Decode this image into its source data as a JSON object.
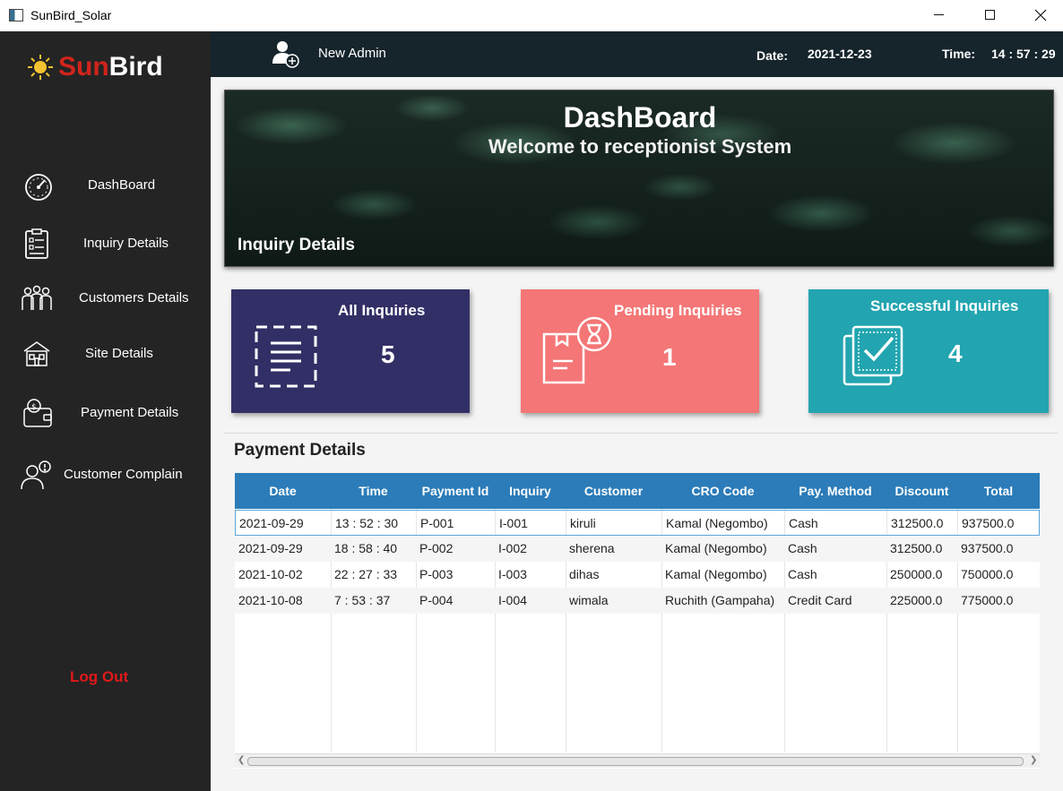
{
  "window": {
    "title": "SunBird_Solar"
  },
  "logo": {
    "sun": "Sun",
    "bird": "Bird"
  },
  "sidebar": {
    "items": [
      {
        "label": "DashBoard",
        "icon": "speedometer-icon"
      },
      {
        "label": "Inquiry Details",
        "icon": "clipboard-icon"
      },
      {
        "label": "Customers Details",
        "icon": "people-icon"
      },
      {
        "label": "Site Details",
        "icon": "house-icon"
      },
      {
        "label": "Payment Details",
        "icon": "wallet-icon"
      },
      {
        "label": "Customer Complain",
        "icon": "complaint-icon"
      }
    ],
    "logout": "Log Out"
  },
  "header": {
    "admin_name": "New Admin",
    "date_label": "Date:",
    "date_value": "2021-12-23",
    "time_label": "Time:",
    "time_value": "14 : 57 : 29"
  },
  "banner": {
    "title": "DashBoard",
    "subtitle": "Welcome to receptionist System",
    "section": "Inquiry Details"
  },
  "cards": [
    {
      "title": "All Inquiries",
      "value": "5",
      "color": "#322f66",
      "icon": "list-icon"
    },
    {
      "title": "Pending Inquiries",
      "value": "1",
      "color": "#f47676",
      "icon": "hourglass-box-icon"
    },
    {
      "title": "Successful Inquiries",
      "value": "4",
      "color": "#22a5b0",
      "icon": "checked-box-icon"
    }
  ],
  "payments": {
    "title": "Payment Details",
    "columns": [
      "Date",
      "Time",
      "Payment Id",
      "Inquiry",
      "Customer",
      "CRO Code",
      "Pay. Method",
      "Discount",
      "Total"
    ],
    "rows": [
      [
        "2021-09-29",
        "13 : 52 : 30",
        "P-001",
        "I-001",
        "kiruli",
        "Kamal (Negombo)",
        "Cash",
        "312500.0",
        "937500.0"
      ],
      [
        "2021-09-29",
        "18 : 58 : 40",
        "P-002",
        "I-002",
        "sherena",
        "Kamal (Negombo)",
        "Cash",
        "312500.0",
        "937500.0"
      ],
      [
        "2021-10-02",
        "22 : 27 : 33",
        "P-003",
        "I-003",
        "dihas",
        "Kamal (Negombo)",
        "Cash",
        "250000.0",
        "750000.0"
      ],
      [
        "2021-10-08",
        "7 : 53 : 37",
        "P-004",
        "I-004",
        "wimala",
        "Ruchith (Gampaha)",
        "Credit Card",
        "225000.0",
        "775000.0"
      ]
    ]
  }
}
